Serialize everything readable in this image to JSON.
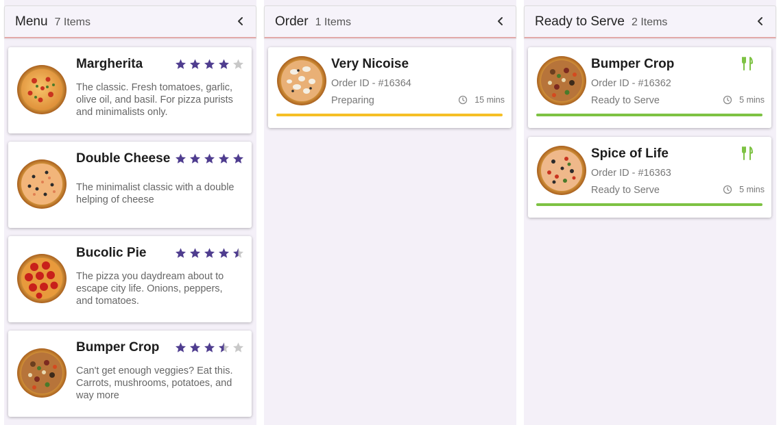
{
  "menu": {
    "title": "Menu",
    "count": "7 Items",
    "items": [
      {
        "name": "Margherita",
        "rating": 4,
        "description": "The classic. Fresh tomatoes, garlic, olive oil, and basil. For pizza purists and minimalists only."
      },
      {
        "name": "Double Cheese",
        "rating": 5,
        "description": "The minimalist classic with a double helping of cheese"
      },
      {
        "name": "Bucolic Pie",
        "rating": 4.5,
        "description": "The pizza you daydream about to escape city life. Onions, peppers, and tomatoes."
      },
      {
        "name": "Bumper Crop",
        "rating": 3.5,
        "description": "Can't get enough veggies? Eat this. Carrots, mushrooms, potatoes, and way more"
      }
    ]
  },
  "order": {
    "title": "Order",
    "count": "1 Items",
    "items": [
      {
        "name": "Very Nicoise",
        "order_id": "Order ID - #16364",
        "status": "Preparing",
        "time": "15 mins"
      }
    ]
  },
  "ready": {
    "title": "Ready to Serve",
    "count": "2 Items",
    "items": [
      {
        "name": "Bumper Crop",
        "order_id": "Order ID - #16362",
        "status": "Ready to Serve",
        "time": "5 mins"
      },
      {
        "name": "Spice of Life",
        "order_id": "Order ID - #16363",
        "status": "Ready to Serve",
        "time": "5 mins"
      }
    ]
  },
  "icons": {
    "collapse": "chevron-left-icon",
    "star": "star-icon",
    "clock": "clock-icon",
    "served": "fork-knife-icon"
  },
  "colors": {
    "star": "#4f3d8f",
    "star_empty": "#c8c8c8",
    "preparing": "#f5bf25",
    "ready": "#7dc243",
    "header_rule": "#e2a9a9"
  }
}
